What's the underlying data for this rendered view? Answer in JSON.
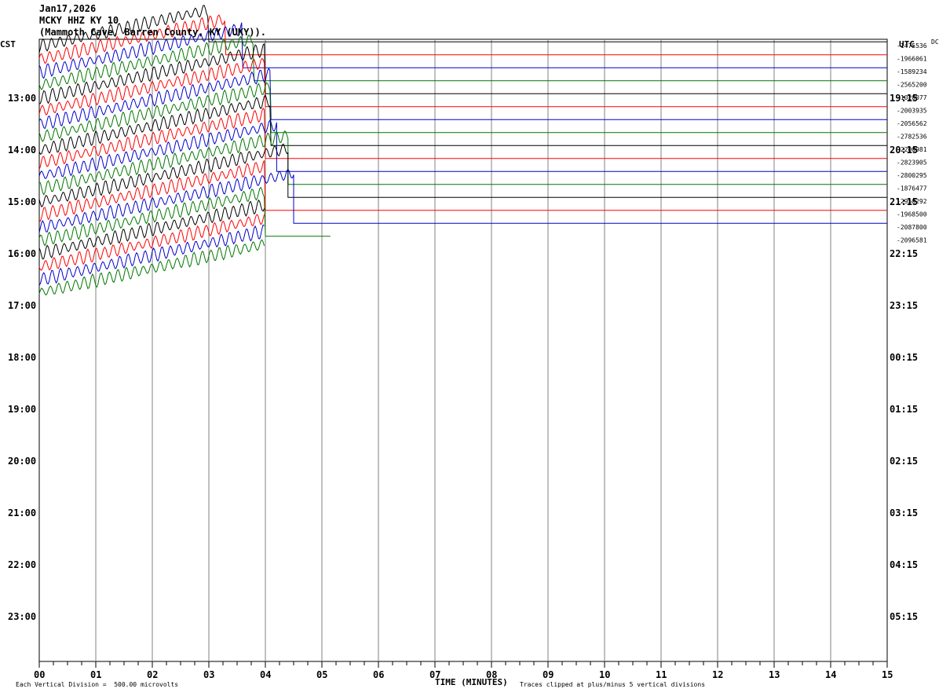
{
  "header": {
    "date": "Jan17,2026",
    "station": "MCKY HHZ KY 10",
    "location": "(Mammoth Cave, Barren County, KY (UKY))."
  },
  "left_tz": "CST",
  "right_tz": "UTC",
  "right_top_label": "DC",
  "footer": {
    "scale_note": "Each Vertical Division =  500.00 microvolts",
    "x_title": "TIME (MINUTES)",
    "clip_note": "Traces clipped at plus/minus 5 vertical divisions"
  },
  "colors": {
    "trace_cycle": [
      "#000000",
      "#ff0000",
      "#0000cc",
      "#007700"
    ],
    "gridline": "#808080"
  },
  "chart_data": {
    "type": "line",
    "xlabel": "TIME (MINUTES)",
    "xlim": [
      0,
      15
    ],
    "x_ticks": [
      "00",
      "01",
      "02",
      "03",
      "04",
      "05",
      "06",
      "07",
      "08",
      "09",
      "10",
      "11",
      "12",
      "13",
      "14",
      "15"
    ],
    "left_hour_labels": [
      "13:00",
      "14:00",
      "15:00",
      "16:00",
      "17:00",
      "18:00",
      "19:00",
      "20:00",
      "21:00",
      "22:00",
      "23:00"
    ],
    "right_hour_labels": [
      "19:15",
      "20:15",
      "21:15",
      "22:15",
      "23:15",
      "00:15",
      "01:15",
      "02:15",
      "03:15",
      "04:15",
      "05:15"
    ],
    "rows_per_hour": 4,
    "first_row_offset_quarter_hours": -4,
    "dc_values": [
      "-1475536",
      "-1966061",
      "-1589234",
      "-2565200",
      "-1020077",
      "-2003935",
      "-2056562",
      "-2782536",
      "-2200981",
      "-2823905",
      "-2800295",
      "-1876477",
      "-2950292",
      "-1968500",
      "-2087800",
      "-2096581"
    ],
    "traces": [
      {
        "row": -4,
        "color": "#000000",
        "end_minute": 15,
        "signal_end_minute": 3.0
      },
      {
        "row": -3,
        "color": "#ff0000",
        "end_minute": 15,
        "signal_end_minute": 3.3
      },
      {
        "row": -2,
        "color": "#0000cc",
        "end_minute": 15,
        "signal_end_minute": 3.6
      },
      {
        "row": -1,
        "color": "#007700",
        "end_minute": 15,
        "signal_end_minute": 3.8
      },
      {
        "row": 0,
        "color": "#000000",
        "end_minute": 15,
        "signal_end_minute": 4.0
      },
      {
        "row": 1,
        "color": "#ff0000",
        "end_minute": 15,
        "signal_end_minute": 4.0
      },
      {
        "row": 2,
        "color": "#0000cc",
        "end_minute": 15,
        "signal_end_minute": 4.1
      },
      {
        "row": 3,
        "color": "#007700",
        "end_minute": 15,
        "signal_end_minute": 4.1
      },
      {
        "row": 4,
        "color": "#000000",
        "end_minute": 15,
        "signal_end_minute": 4.1
      },
      {
        "row": 5,
        "color": "#ff0000",
        "end_minute": 15,
        "signal_end_minute": 4.0
      },
      {
        "row": 6,
        "color": "#0000cc",
        "end_minute": 15,
        "signal_end_minute": 4.2
      },
      {
        "row": 7,
        "color": "#007700",
        "end_minute": 15,
        "signal_end_minute": 4.4
      },
      {
        "row": 8,
        "color": "#000000",
        "end_minute": 15,
        "signal_end_minute": 4.4
      },
      {
        "row": 9,
        "color": "#ff0000",
        "end_minute": 15,
        "signal_end_minute": 4.0
      },
      {
        "row": 10,
        "color": "#0000cc",
        "end_minute": 15,
        "signal_end_minute": 4.5
      },
      {
        "row": 11,
        "color": "#007700",
        "end_minute": 5.15,
        "signal_end_minute": 4.0
      },
      {
        "row": 12,
        "color": "#000000",
        "end_minute": 0,
        "signal_end_minute": 4.0
      },
      {
        "row": 13,
        "color": "#ff0000",
        "end_minute": 0,
        "signal_end_minute": 4.0
      },
      {
        "row": 14,
        "color": "#0000cc",
        "end_minute": 0,
        "signal_end_minute": 4.0
      },
      {
        "row": 15,
        "color": "#007700",
        "end_minute": 0,
        "signal_end_minute": 4.0
      }
    ]
  }
}
